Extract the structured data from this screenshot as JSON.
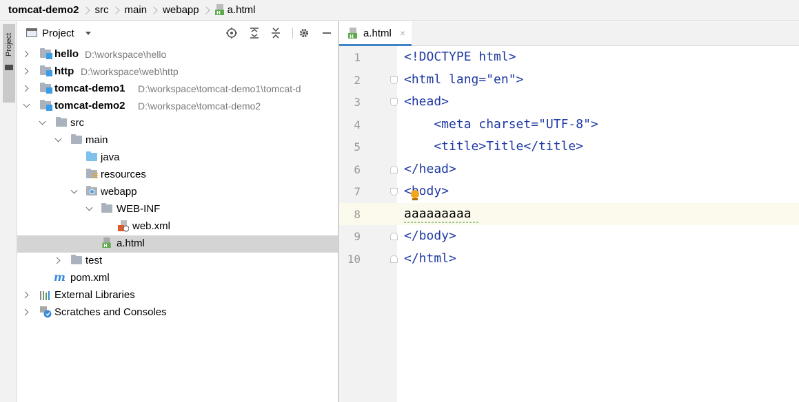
{
  "breadcrumb": [
    "tomcat-demo2",
    "src",
    "main",
    "webapp",
    "a.html"
  ],
  "tool_window": {
    "stripe_label": "Project"
  },
  "panel": {
    "title": "Project",
    "toolbar_icons": [
      "locate-icon",
      "expand-all-icon",
      "collapse-all-icon",
      "settings-icon",
      "hide-icon"
    ]
  },
  "tree": [
    {
      "label": "hello",
      "path": "D:\\workspace\\hello",
      "bold": true,
      "icon": "module-folder-icon",
      "arrow": "right",
      "level": 0
    },
    {
      "label": "http",
      "path": "D:\\workspace\\web\\http",
      "bold": true,
      "icon": "module-folder-icon",
      "arrow": "right",
      "level": 0
    },
    {
      "label": "tomcat-demo1",
      "path": "D:\\workspace\\tomcat-demo1\\tomcat-d",
      "bold": true,
      "icon": "module-folder-icon",
      "arrow": "right",
      "level": 0
    },
    {
      "label": "tomcat-demo2",
      "path": "D:\\workspace\\tomcat-demo2",
      "bold": true,
      "icon": "module-folder-icon",
      "arrow": "down",
      "level": 0
    },
    {
      "label": "src",
      "icon": "folder-icon",
      "arrow": "down",
      "level": 1
    },
    {
      "label": "main",
      "icon": "folder-icon",
      "arrow": "down",
      "level": 2
    },
    {
      "label": "java",
      "icon": "source-folder-icon",
      "arrow": "none",
      "level": 3
    },
    {
      "label": "resources",
      "icon": "resources-folder-icon",
      "arrow": "none",
      "level": 3
    },
    {
      "label": "webapp",
      "icon": "web-folder-icon",
      "arrow": "down",
      "level": 3
    },
    {
      "label": "WEB-INF",
      "icon": "folder-icon",
      "arrow": "down",
      "level": 4
    },
    {
      "label": "web.xml",
      "icon": "xml-file-icon",
      "arrow": "none",
      "level": 5
    },
    {
      "label": "a.html",
      "icon": "html-file-icon",
      "arrow": "none",
      "level": 4,
      "selected": true
    },
    {
      "label": "test",
      "icon": "folder-icon",
      "arrow": "right",
      "level": 2
    },
    {
      "label": "pom.xml",
      "icon": "maven-icon",
      "arrow": "none",
      "level": 1
    },
    {
      "label": "External Libraries",
      "icon": "libraries-icon",
      "arrow": "right",
      "level": 0
    },
    {
      "label": "Scratches and Consoles",
      "icon": "scratches-icon",
      "arrow": "right",
      "level": 0
    }
  ],
  "editor": {
    "tab_label": "a.html",
    "tab_close": "×",
    "line_numbers": [
      "1",
      "2",
      "3",
      "4",
      "5",
      "6",
      "7",
      "8",
      "9",
      "10"
    ],
    "code_lines": [
      "<!DOCTYPE html>",
      "<html lang=\"en\">",
      "<head>",
      "    <meta charset=\"UTF-8\">",
      "    <title>Title</title>",
      "</head>",
      "<body>",
      "aaaaaaaaa",
      "</body>",
      "</html>"
    ],
    "current_line": "8"
  }
}
